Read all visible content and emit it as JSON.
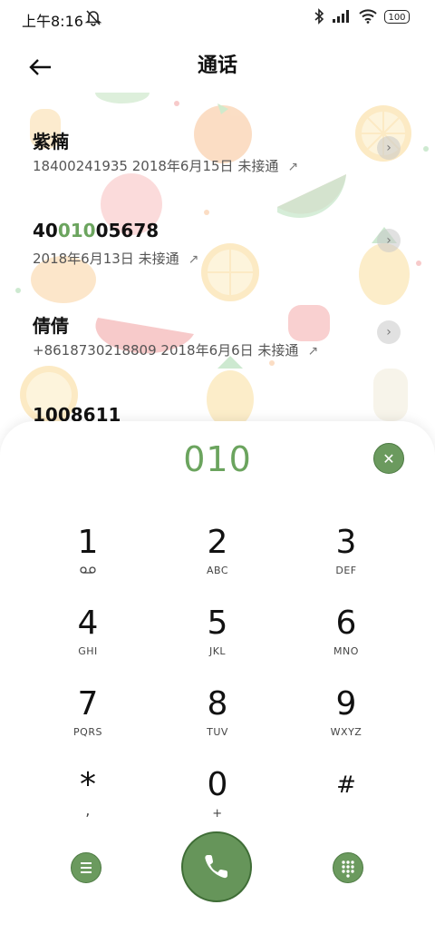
{
  "status_bar": {
    "time": "上午8:16",
    "battery": "100",
    "icons": [
      "mute-bell-icon",
      "bluetooth-icon",
      "signal-icon",
      "wifi-icon",
      "battery-icon"
    ]
  },
  "header": {
    "title": "通话",
    "back_icon": "back-arrow-icon"
  },
  "calls": [
    {
      "name": "紫楠",
      "name_parts": [
        "紫楠",
        "",
        ""
      ],
      "detail": "18400241935  2018年6月15日  未接通"
    },
    {
      "name": "4001005678",
      "name_parts": [
        "40",
        "010",
        "05678"
      ],
      "detail": "2018年6月13日  未接通"
    },
    {
      "name": "倩倩",
      "name_parts": [
        "倩倩",
        "",
        ""
      ],
      "detail": "+8618730218809  2018年6月6日  未接通"
    },
    {
      "name": "1008611",
      "name_parts": [
        "1008611",
        "",
        ""
      ],
      "detail": ""
    }
  ],
  "dialer": {
    "number": "010",
    "clear_icon": "close-icon",
    "keys": [
      {
        "digit": "1",
        "letters": ""
      },
      {
        "digit": "2",
        "letters": "ABC"
      },
      {
        "digit": "3",
        "letters": "DEF"
      },
      {
        "digit": "4",
        "letters": "GHI"
      },
      {
        "digit": "5",
        "letters": "JKL"
      },
      {
        "digit": "6",
        "letters": "MNO"
      },
      {
        "digit": "7",
        "letters": "PQRS"
      },
      {
        "digit": "8",
        "letters": "TUV"
      },
      {
        "digit": "9",
        "letters": "WXYZ"
      },
      {
        "digit": "*",
        "letters": ","
      },
      {
        "digit": "0",
        "letters": "+"
      },
      {
        "digit": "#",
        "letters": ""
      }
    ],
    "voicemail_icon": "voicemail-icon",
    "menu_icon": "menu-icon",
    "call_icon": "phone-icon",
    "keypad_icon": "keypad-icon"
  },
  "colors": {
    "accent": "#6ba45e",
    "button": "#6b9a5e",
    "call_button": "#66955a"
  }
}
